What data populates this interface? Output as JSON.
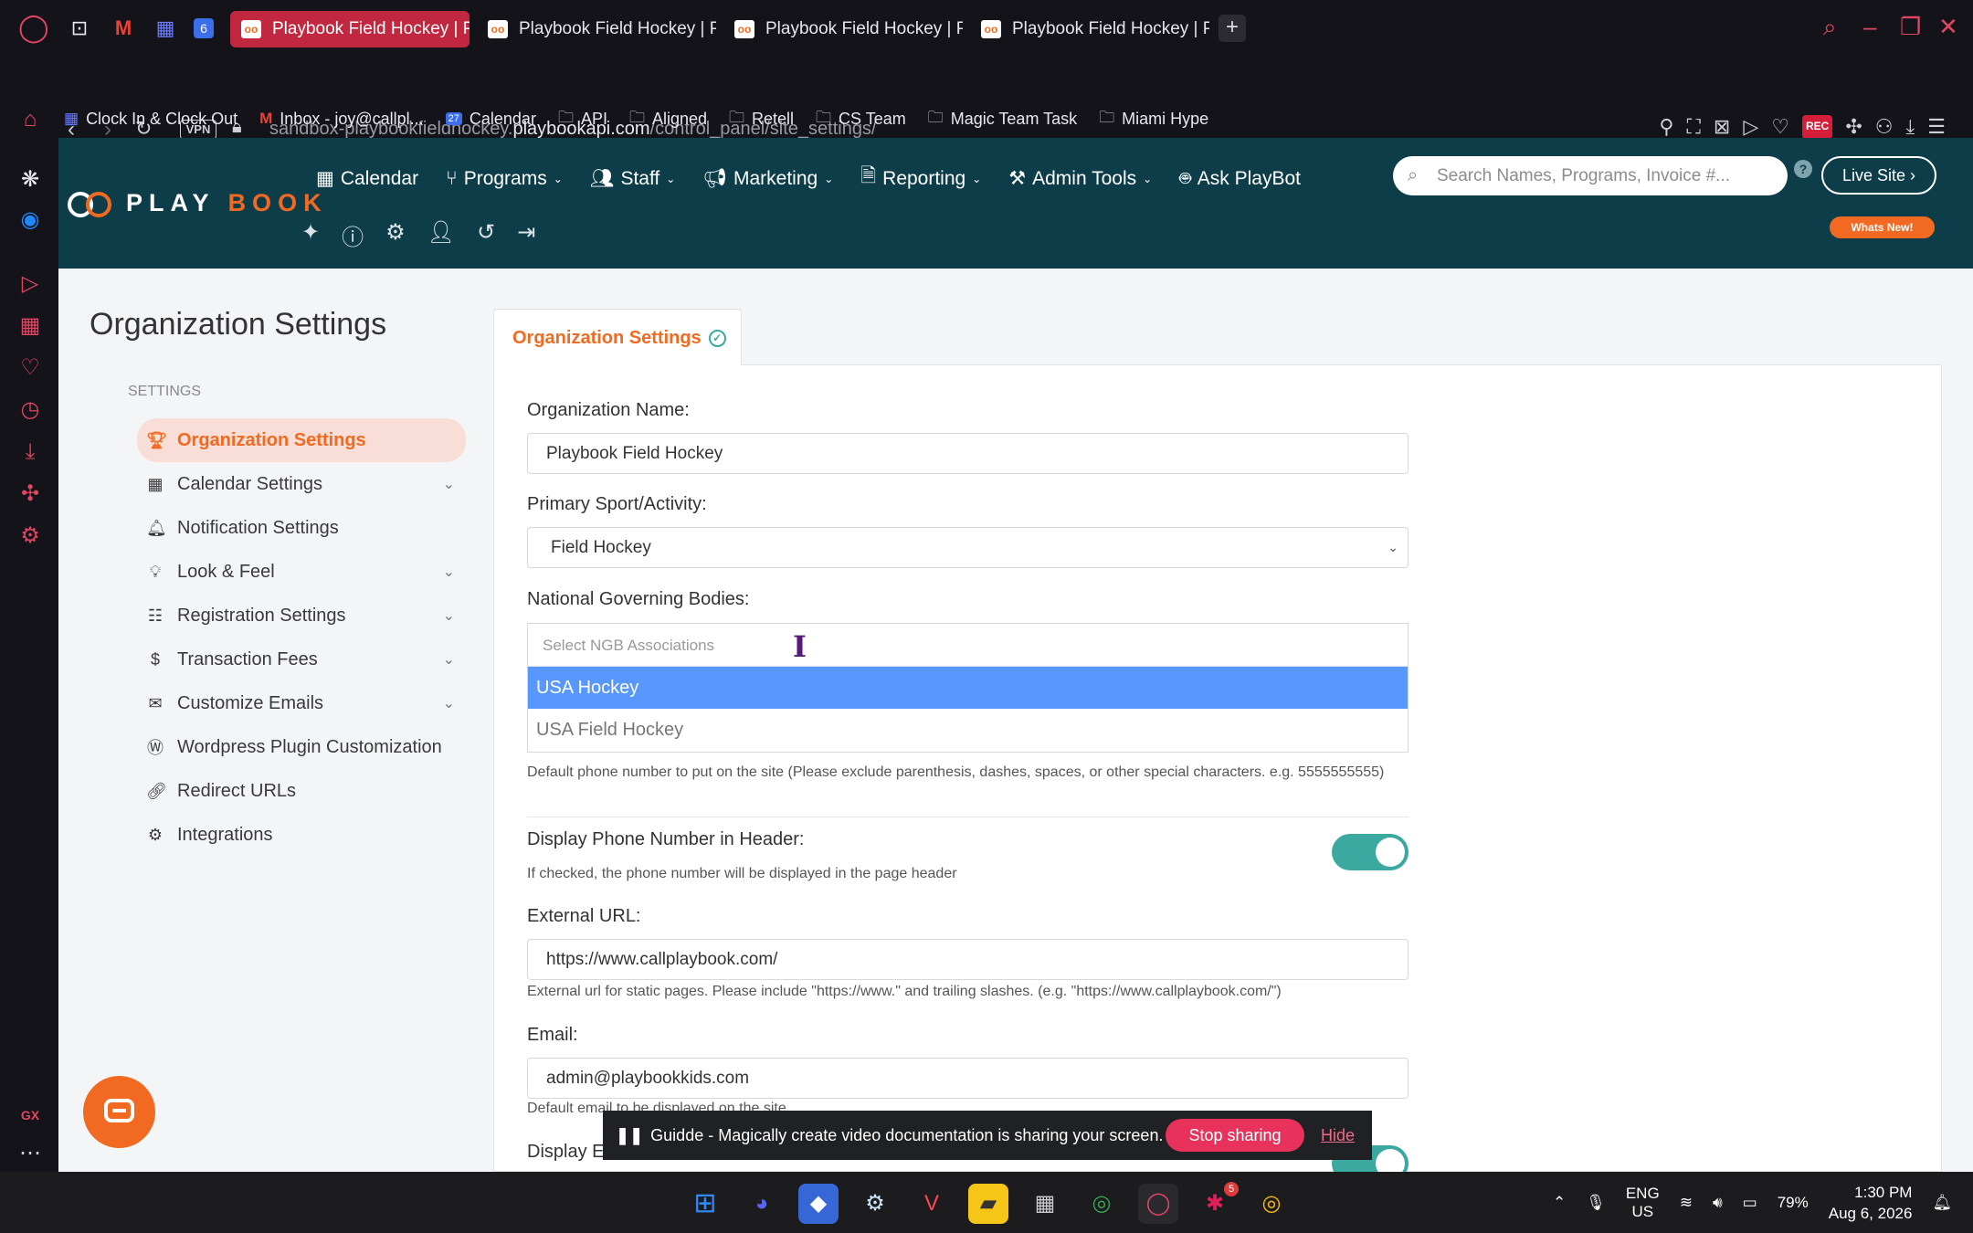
{
  "browser": {
    "tabs": [
      {
        "title": "Playbook Field Hockey | Pla",
        "active": true
      },
      {
        "title": "Playbook Field Hockey | Pl",
        "active": false
      },
      {
        "title": "Playbook Field Hockey | Pl",
        "active": false
      },
      {
        "title": "Playbook Field Hockey | Pla",
        "active": false
      }
    ],
    "pinned_badge": "6",
    "new_tab": "+",
    "vpn_label": "VPN",
    "url_prefix": "sandbox-playbookfieldhockey.",
    "url_domain": "playbookapi.com",
    "url_path": "/control_panel/site_settings/",
    "rec_label": "REC",
    "bookmarks": [
      {
        "label": "Clock In & Clock Out",
        "icon": "calendar-app-icon"
      },
      {
        "label": "Inbox - joy@callpl...",
        "icon": "gmail-icon"
      },
      {
        "label": "Calendar",
        "icon": "calendar-icon"
      },
      {
        "label": "API",
        "icon": "folder-icon"
      },
      {
        "label": "Aligned",
        "icon": "folder-icon"
      },
      {
        "label": "Retell",
        "icon": "folder-icon"
      },
      {
        "label": "CS Team",
        "icon": "folder-icon"
      },
      {
        "label": "Magic Team Task",
        "icon": "folder-icon"
      },
      {
        "label": "Miami Hype",
        "icon": "folder-icon"
      }
    ],
    "calendar_day": "27",
    "gx_label": "GX"
  },
  "header": {
    "logo_play": "PLAY",
    "logo_book": "BOOK",
    "nav": [
      {
        "label": "Calendar",
        "icon": "calendar-icon",
        "caret": false
      },
      {
        "label": "Programs",
        "icon": "branch-icon",
        "caret": true
      },
      {
        "label": "Staff",
        "icon": "users-icon",
        "caret": true
      },
      {
        "label": "Marketing",
        "icon": "megaphone-icon",
        "caret": true
      },
      {
        "label": "Reporting",
        "icon": "file-icon",
        "caret": true
      },
      {
        "label": "Admin Tools",
        "icon": "tools-icon",
        "caret": true
      },
      {
        "label": "Ask PlayBot",
        "icon": "robot-icon",
        "caret": false
      }
    ],
    "search_placeholder": "Search Names, Programs, Invoice #...",
    "live_site": "Live Site",
    "whats_new": "Whats New!"
  },
  "page": {
    "title": "Organization Settings",
    "settings_heading": "SETTINGS",
    "sidebar": [
      {
        "label": "Organization Settings",
        "icon": "trophy-icon",
        "active": true,
        "expandable": false
      },
      {
        "label": "Calendar Settings",
        "icon": "calendar-icon",
        "active": false,
        "expandable": true
      },
      {
        "label": "Notification Settings",
        "icon": "bell-icon",
        "active": false,
        "expandable": false
      },
      {
        "label": "Look & Feel",
        "icon": "lightbulb-icon",
        "active": false,
        "expandable": true
      },
      {
        "label": "Registration Settings",
        "icon": "form-icon",
        "active": false,
        "expandable": true
      },
      {
        "label": "Transaction Fees",
        "icon": "dollar-icon",
        "active": false,
        "expandable": true
      },
      {
        "label": "Customize Emails",
        "icon": "envelope-icon",
        "active": false,
        "expandable": true
      },
      {
        "label": "Wordpress Plugin Customization",
        "icon": "wordpress-icon",
        "active": false,
        "expandable": false
      },
      {
        "label": "Redirect URLs",
        "icon": "link-icon",
        "active": false,
        "expandable": false
      },
      {
        "label": "Integrations",
        "icon": "cogs-icon",
        "active": false,
        "expandable": false
      }
    ],
    "tab_label": "Organization Settings",
    "form": {
      "org_name_label": "Organization Name:",
      "org_name_value": "Playbook Field Hockey",
      "sport_label": "Primary Sport/Activity:",
      "sport_value": "Field Hockey",
      "ngb_label": "National Governing Bodies:",
      "ngb_placeholder": "Select NGB Associations",
      "ngb_options": [
        "USA Hockey",
        "USA Field Hockey"
      ],
      "phone_help": "Default phone number to put on the site (Please exclude parenthesis, dashes, spaces, or other special characters. e.g. 5555555555)",
      "display_phone_label": "Display Phone Number in Header:",
      "display_phone_help": "If checked, the phone number will be displayed in the page header",
      "display_phone_on": true,
      "external_url_label": "External URL:",
      "external_url_value": "https://www.callplaybook.com/",
      "external_url_help": "External url for static pages. Please include \"https://www.\" and trailing slashes. (e.g. \"https://www.callplaybook.com/\")",
      "email_label": "Email:",
      "email_value": "admin@playbookkids.com",
      "email_help": "Default email to be displayed on the site",
      "display_email_label": "Display Email Address in Header:"
    }
  },
  "share_bar": {
    "text": "Guidde - Magically create video documentation is sharing your screen.",
    "stop": "Stop sharing",
    "hide": "Hide"
  },
  "taskbar": {
    "slack_badge": "5",
    "lang1": "ENG",
    "lang2": "US",
    "battery": "79%",
    "time": "1:30 PM",
    "date": "Aug 6, 2026"
  }
}
